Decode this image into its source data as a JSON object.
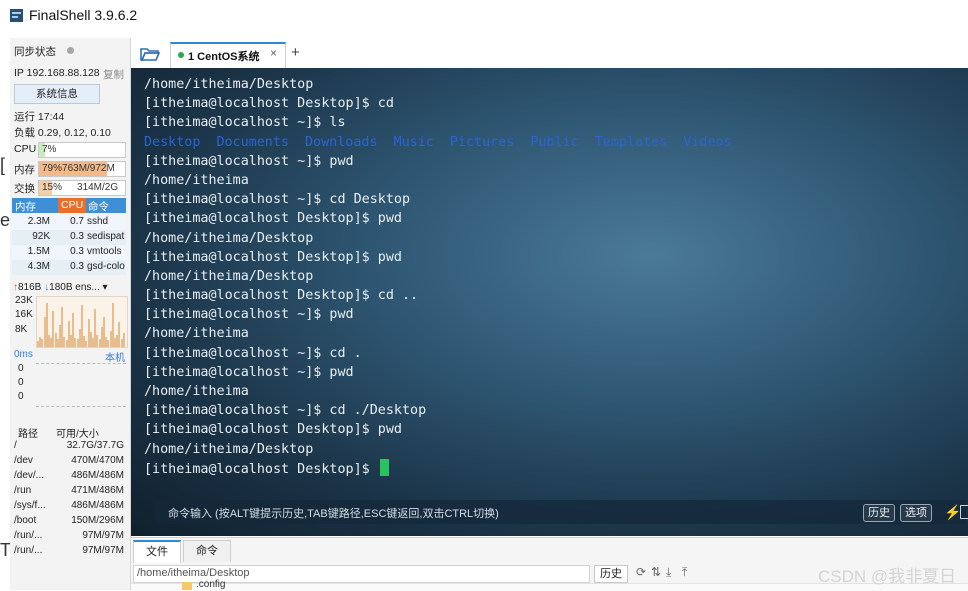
{
  "app": {
    "title": "FinalShell 3.9.6.2"
  },
  "sidebar": {
    "sync_label": "同步状态",
    "ip_label": "IP 192.168.88.128",
    "copy_label": "复制",
    "sysinfo_button": "系统信息",
    "uptime": "运行 17:44",
    "load": "负载 0.29, 0.12, 0.10",
    "cpu": {
      "label": "CPU",
      "value": "7%",
      "fraction": 0.07
    },
    "mem": {
      "label": "内存",
      "percent": "79%",
      "value": "763M/972M",
      "fraction": 0.79
    },
    "swap": {
      "label": "交换",
      "percent": "15%",
      "value": "314M/2G",
      "fraction": 0.15
    },
    "proc_headers": {
      "mem": "内存",
      "cpu": "CPU",
      "cmd": "命令"
    },
    "processes": [
      {
        "mem": "2.3M",
        "cpu": "0.7",
        "cmd": "sshd"
      },
      {
        "mem": "92K",
        "cpu": "0.3",
        "cmd": "sedispat"
      },
      {
        "mem": "1.5M",
        "cpu": "0.3",
        "cmd": "vmtools"
      },
      {
        "mem": "4.3M",
        "cpu": "0.3",
        "cmd": "gsd-colo"
      }
    ],
    "net": {
      "up": "816B",
      "down": "180B",
      "iface": "ens..."
    },
    "net_axis": [
      "23K",
      "16K",
      "8K"
    ],
    "ping": {
      "label": "0ms",
      "host": "本机",
      "values": [
        "0",
        "0",
        "0"
      ]
    },
    "disk_headers": {
      "path": "路径",
      "size": "可用/大小"
    },
    "disks": [
      {
        "path": "/",
        "size": "32.7G/37.7G"
      },
      {
        "path": "/dev",
        "size": "470M/470M"
      },
      {
        "path": "/dev/...",
        "size": "486M/486M"
      },
      {
        "path": "/run",
        "size": "471M/486M"
      },
      {
        "path": "/sys/f...",
        "size": "486M/486M"
      },
      {
        "path": "/boot",
        "size": "150M/296M"
      },
      {
        "path": "/run/...",
        "size": "97M/97M"
      },
      {
        "path": "/run/...",
        "size": "97M/97M"
      }
    ]
  },
  "tabs": {
    "active_label": "1 CentOS系统",
    "close": "×",
    "add": "+"
  },
  "terminal": {
    "lines": [
      "/home/itheima/Desktop",
      "[itheima@localhost Desktop]$ cd",
      "[itheima@localhost ~]$ ls",
      "",
      "[itheima@localhost ~]$ pwd",
      "/home/itheima",
      "[itheima@localhost ~]$ cd Desktop",
      "[itheima@localhost Desktop]$ pwd",
      "/home/itheima/Desktop",
      "[itheima@localhost Desktop]$ pwd",
      "/home/itheima/Desktop",
      "[itheima@localhost Desktop]$ cd ..",
      "[itheima@localhost ~]$ pwd",
      "/home/itheima",
      "[itheima@localhost ~]$ cd .",
      "[itheima@localhost ~]$ pwd",
      "/home/itheima",
      "[itheima@localhost ~]$ cd ./Desktop",
      "[itheima@localhost Desktop]$ pwd",
      "/home/itheima/Desktop",
      "[itheima@localhost Desktop]$ "
    ],
    "ls_output": [
      "Desktop",
      "Documents",
      "Downloads",
      "Music",
      "Pictures",
      "Public",
      "Templates",
      "Videos"
    ],
    "dir_color": "#2b63d8",
    "cursor_color": "#22c55e"
  },
  "cmdbar": {
    "hint": "命令输入 (按ALT键提示历史,TAB键路径,ESC键返回,双击CTRL切换)",
    "history": "历史",
    "options": "选项"
  },
  "bottom": {
    "tab_files": "文件",
    "tab_commands": "命令",
    "path": "/home/itheima/Desktop",
    "history": "历史",
    "file_peek": ".config"
  },
  "watermark": "CSDN @我非夏日",
  "colors": {
    "accent": "#2e8ad8",
    "status_green": "#2ca84f",
    "mem_bar": "#f2b98a",
    "proc_header": "#3d8fd6"
  }
}
